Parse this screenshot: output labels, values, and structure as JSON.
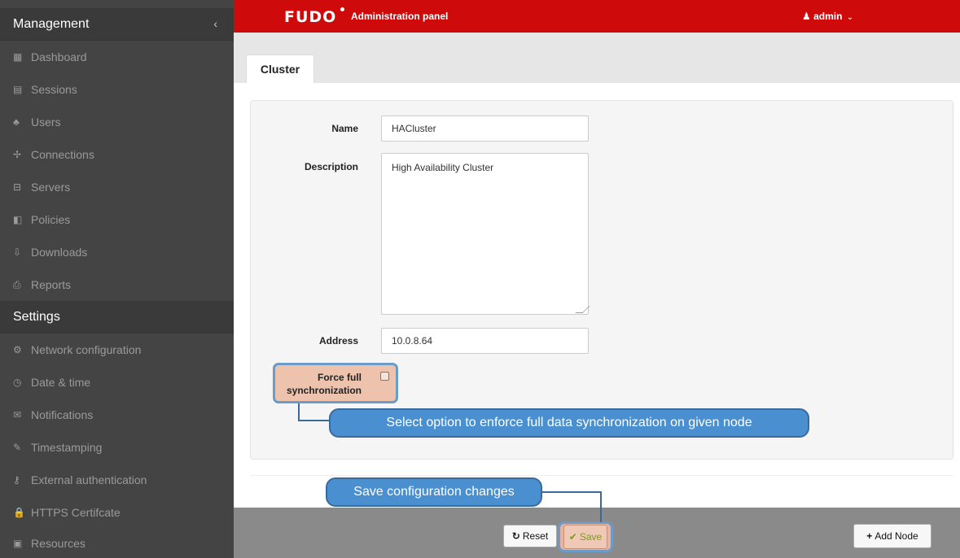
{
  "sidebar": {
    "management_title": "Management",
    "collapse_glyph": "‹",
    "management_items": [
      {
        "label": "Dashboard",
        "icon": "▦"
      },
      {
        "label": "Sessions",
        "icon": "▤"
      },
      {
        "label": "Users",
        "icon": "♣"
      },
      {
        "label": "Connections",
        "icon": "✢"
      },
      {
        "label": "Servers",
        "icon": "⊟"
      },
      {
        "label": "Policies",
        "icon": "◧"
      },
      {
        "label": "Downloads",
        "icon": "⇩"
      },
      {
        "label": "Reports",
        "icon": "⎙"
      }
    ],
    "settings_title": "Settings",
    "settings_items": [
      {
        "label": "Network configuration",
        "icon": "⚙"
      },
      {
        "label": "Date & time",
        "icon": "◷"
      },
      {
        "label": "Notifications",
        "icon": "✉"
      },
      {
        "label": "Timestamping",
        "icon": "✎"
      },
      {
        "label": "External authentication",
        "icon": "⚷"
      },
      {
        "label": "HTTPS Certifcate",
        "icon": "🔒"
      },
      {
        "label": "Resources",
        "icon": "▣"
      }
    ]
  },
  "header": {
    "logo": "FUDO",
    "title": "Administration panel",
    "user": "admin",
    "user_icon": "♟",
    "chevron": "⌄"
  },
  "tabs": [
    {
      "label": "Cluster"
    }
  ],
  "form": {
    "name_label": "Name",
    "name_value": "HACluster",
    "description_label": "Description",
    "description_value": "High Availability Cluster",
    "address_label": "Address",
    "address_value": "10.0.8.64",
    "force_label": "Force full synchronization",
    "force_checked": false
  },
  "footer": {
    "reset_label": "Reset",
    "reset_icon": "↻",
    "save_label": "Save",
    "save_icon": "✔",
    "add_node_label": "Add Node",
    "add_node_icon": "+"
  },
  "callouts": {
    "force_sync": "Select option to enforce full data synchronization on given node",
    "save": "Save configuration changes"
  },
  "colors": {
    "topbar": "#cf0a0a",
    "sidebar": "#444444",
    "callout": "#4a8fcf",
    "highlight": "#edc3ad"
  }
}
